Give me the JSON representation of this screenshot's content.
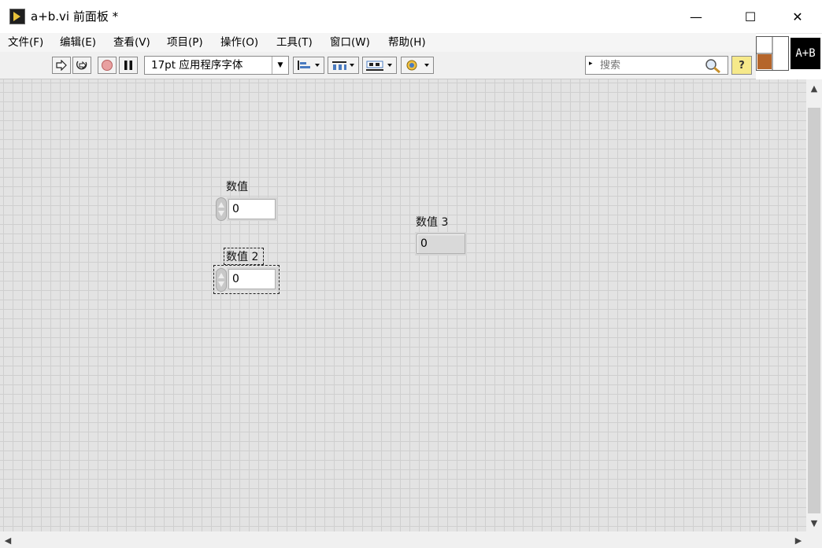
{
  "window": {
    "title": "a+b.vi 前面板 *",
    "minimize_glyph": "—",
    "maximize_glyph": "☐",
    "close_glyph": "✕"
  },
  "menu": {
    "items": [
      "文件(F)",
      "编辑(E)",
      "查看(V)",
      "项目(P)",
      "操作(O)",
      "工具(T)",
      "窗口(W)",
      "帮助(H)"
    ]
  },
  "toolbar": {
    "run_icon": "run-arrow-icon",
    "run_continuous_icon": "run-continuously-icon",
    "abort_icon": "abort-icon",
    "pause_icon": "pause-icon",
    "font_select_value": "17pt 应用程序字体",
    "align_icon": "align-objects-icon",
    "distribute_icon": "distribute-objects-icon",
    "resize_icon": "resize-objects-icon",
    "reorder_icon": "reorder-icon",
    "search_placeholder": "搜索",
    "help_label": "?"
  },
  "vi_icon": {
    "text": "A+B"
  },
  "front_panel": {
    "controls": [
      {
        "label": "数值",
        "value": "0",
        "kind": "control"
      },
      {
        "label": "数值 2",
        "value": "0",
        "kind": "control",
        "selected": true
      }
    ],
    "indicators": [
      {
        "label": "数值 3",
        "value": "0",
        "kind": "indicator"
      }
    ]
  },
  "colors": {
    "panel_bg": "#e3e3e3",
    "grid_line": "#cfcfcf",
    "help_btn_bg": "#f6e98a"
  }
}
